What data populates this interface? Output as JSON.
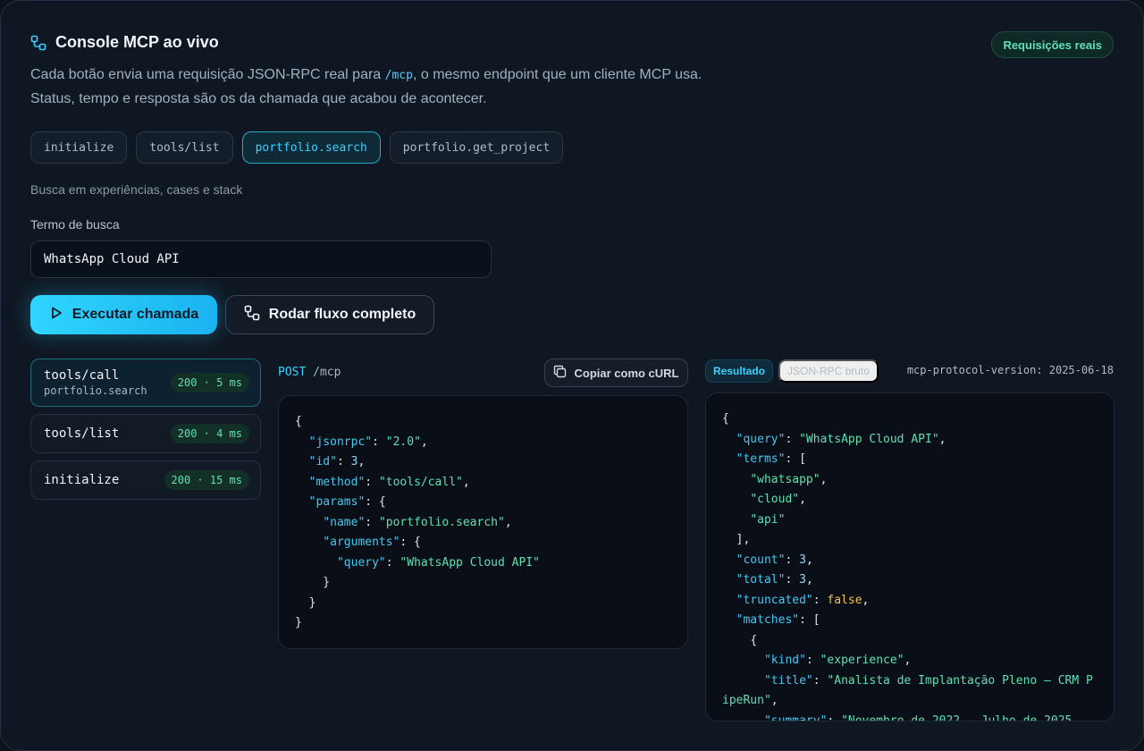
{
  "header": {
    "title": "Console MCP ao vivo",
    "badge": "Requisições reais",
    "description_before": "Cada botão envia uma requisição JSON-RPC real para ",
    "description_code": "/mcp",
    "description_after": ", o mesmo endpoint que um cliente MCP usa. Status, tempo e resposta são os da chamada que acabou de acontecer."
  },
  "methods": [
    "initialize",
    "tools/list",
    "portfolio.search",
    "portfolio.get_project"
  ],
  "active_method": "portfolio.search",
  "hint": "Busca em experiências, cases e stack",
  "search": {
    "label": "Termo de busca",
    "value": "WhatsApp Cloud API"
  },
  "actions": {
    "run": "Executar chamada",
    "flow": "Rodar fluxo completo"
  },
  "history": [
    {
      "name": "tools/call",
      "sub": "portfolio.search",
      "status": "200 · 5 ms",
      "active": true
    },
    {
      "name": "tools/list",
      "sub": "",
      "status": "200 · 4 ms",
      "active": false
    },
    {
      "name": "initialize",
      "sub": "",
      "status": "200 · 15 ms",
      "active": false
    }
  ],
  "request": {
    "verb": "POST",
    "path": "/mcp",
    "copy_label": "Copiar como cURL",
    "body": "{\n  \"jsonrpc\": \"2.0\",\n  \"id\": 3,\n  \"method\": \"tools/call\",\n  \"params\": {\n    \"name\": \"portfolio.search\",\n    \"arguments\": {\n      \"query\": \"WhatsApp Cloud API\"\n    }\n  }\n}"
  },
  "response": {
    "tabs": [
      "Resultado",
      "JSON-RPC bruto"
    ],
    "active_tab": "Resultado",
    "protocol": "mcp-protocol-version: 2025-06-18",
    "body": "{\n  \"query\": \"WhatsApp Cloud API\",\n  \"terms\": [\n    \"whatsapp\",\n    \"cloud\",\n    \"api\"\n  ],\n  \"count\": 3,\n  \"total\": 3,\n  \"truncated\": false,\n  \"matches\": [\n    {\n      \"kind\": \"experience\",\n      \"title\": \"Analista de Implantação Pleno — CRM PipeRun\",\n      \"summary\": \"Novembro de 2022 - Julho de 2025"
  },
  "colors": {
    "accent": "#39d0ff",
    "success": "#5fe0b3",
    "boolean": "#f2c14e",
    "background": "#0f1722"
  },
  "icons": {
    "title": "flow-nodes-icon",
    "run": "play-icon",
    "flow": "flow-nodes-icon",
    "copy": "copy-icon"
  }
}
